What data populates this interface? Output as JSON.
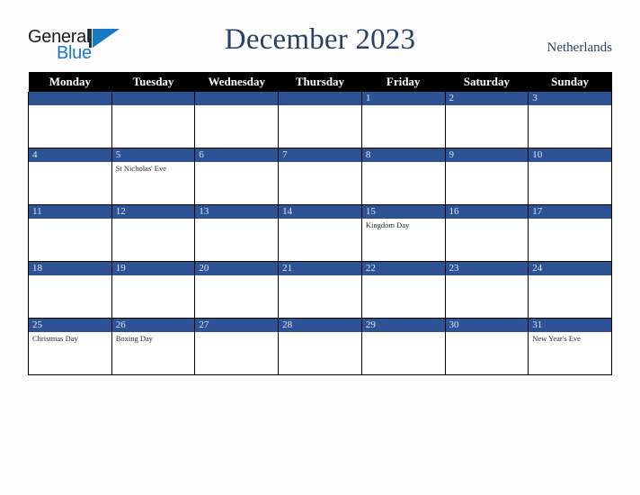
{
  "brand": {
    "name_part1": "General",
    "name_part2": "Blue",
    "mark": "triangle-logo",
    "color_primary": "#1878c4",
    "color_dark": "#15314f"
  },
  "header": {
    "title": "December 2023",
    "country": "Netherlands",
    "title_color": "#2b4268"
  },
  "calendar": {
    "weekday_headers": [
      "Monday",
      "Tuesday",
      "Wednesday",
      "Thursday",
      "Friday",
      "Saturday",
      "Sunday"
    ],
    "header_bg": "#000000",
    "daybar_bg": "#2e5395",
    "daybar_text": "#dfe4ee",
    "grid_border": "#000000",
    "weeks": [
      [
        {
          "day": "",
          "events": []
        },
        {
          "day": "",
          "events": []
        },
        {
          "day": "",
          "events": []
        },
        {
          "day": "",
          "events": []
        },
        {
          "day": "1",
          "events": []
        },
        {
          "day": "2",
          "events": []
        },
        {
          "day": "3",
          "events": []
        }
      ],
      [
        {
          "day": "4",
          "events": []
        },
        {
          "day": "5",
          "events": [
            "St Nicholas' Eve"
          ]
        },
        {
          "day": "6",
          "events": []
        },
        {
          "day": "7",
          "events": []
        },
        {
          "day": "8",
          "events": []
        },
        {
          "day": "9",
          "events": []
        },
        {
          "day": "10",
          "events": []
        }
      ],
      [
        {
          "day": "11",
          "events": []
        },
        {
          "day": "12",
          "events": []
        },
        {
          "day": "13",
          "events": []
        },
        {
          "day": "14",
          "events": []
        },
        {
          "day": "15",
          "events": [
            "Kingdom Day"
          ]
        },
        {
          "day": "16",
          "events": []
        },
        {
          "day": "17",
          "events": []
        }
      ],
      [
        {
          "day": "18",
          "events": []
        },
        {
          "day": "19",
          "events": []
        },
        {
          "day": "20",
          "events": []
        },
        {
          "day": "21",
          "events": []
        },
        {
          "day": "22",
          "events": []
        },
        {
          "day": "23",
          "events": []
        },
        {
          "day": "24",
          "events": []
        }
      ],
      [
        {
          "day": "25",
          "events": [
            "Christmas Day"
          ]
        },
        {
          "day": "26",
          "events": [
            "Boxing Day"
          ]
        },
        {
          "day": "27",
          "events": []
        },
        {
          "day": "28",
          "events": []
        },
        {
          "day": "29",
          "events": []
        },
        {
          "day": "30",
          "events": []
        },
        {
          "day": "31",
          "events": [
            "New Year's Eve"
          ]
        }
      ]
    ]
  }
}
